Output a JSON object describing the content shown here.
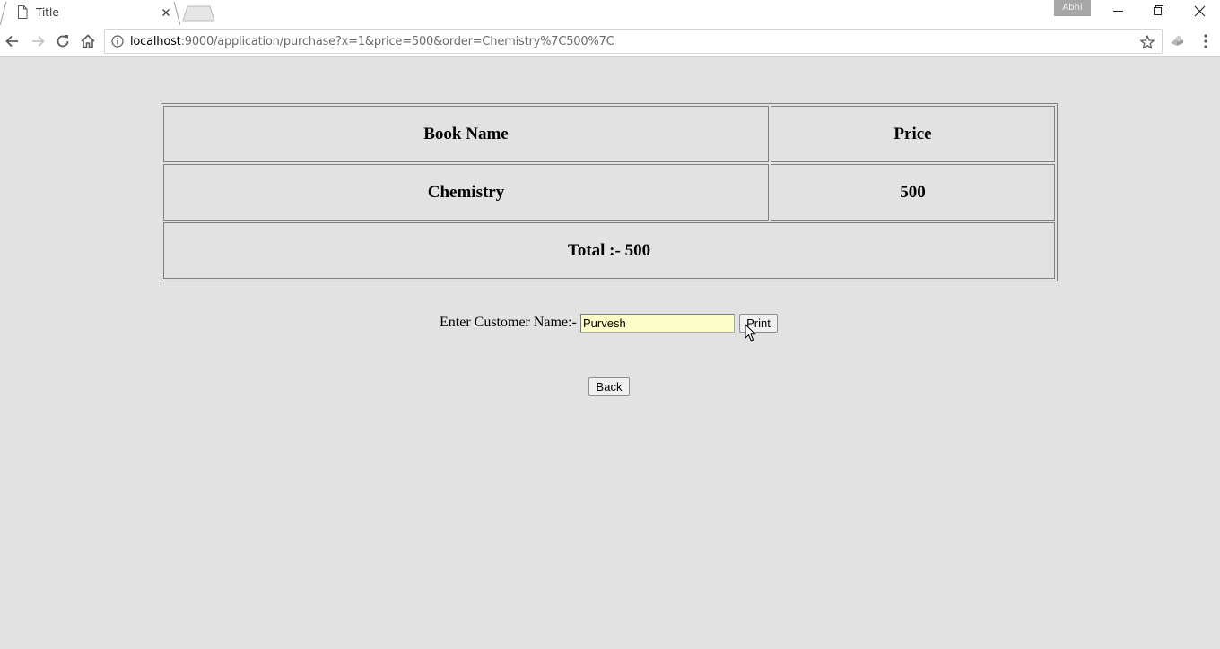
{
  "browser": {
    "tab": {
      "title": "Title",
      "page_icon": "page-icon",
      "close_icon": "close-icon"
    },
    "profile_name": "Abhi",
    "window_controls": [
      "minimize-icon",
      "restore-icon",
      "close-icon"
    ],
    "nav_icons": [
      "back-arrow-icon",
      "forward-arrow-icon",
      "reload-icon",
      "home-icon"
    ],
    "address": {
      "host": "localhost",
      "rest": ":9000/application/purchase?x=1&price=500&order=Chemistry%7C500%7C",
      "info_icon": "info-icon",
      "bookmark_icon": "star-icon"
    },
    "extension_icon": "extension-icon",
    "menu_icon": "more-vert-icon"
  },
  "order": {
    "headers": {
      "name": "Book Name",
      "price": "Price"
    },
    "items": [
      {
        "name": "Chemistry",
        "price": "500"
      }
    ],
    "total_label": "Total :- 500"
  },
  "customer": {
    "label": "Enter Customer Name:-",
    "value": "Purvesh",
    "print_label": "Print"
  },
  "back_label": "Back",
  "colors": {
    "page_background": "#e2e2e2",
    "input_background": "#fdfdc8",
    "table_border": "#808080"
  }
}
